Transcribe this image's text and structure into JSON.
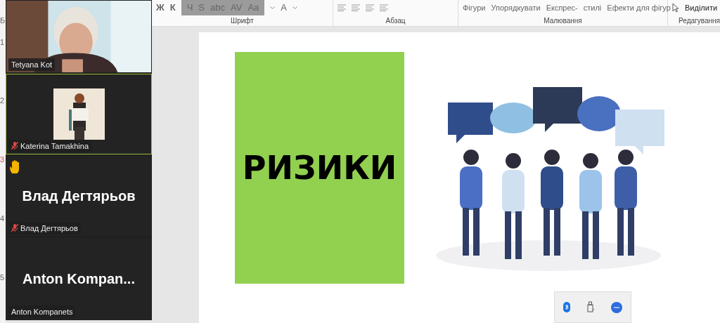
{
  "ruler": {
    "marks": [
      {
        "label": "Б",
        "highlighted": false
      },
      {
        "label": "1",
        "highlighted": false
      },
      {
        "label": "2",
        "highlighted": false
      },
      {
        "label": "3",
        "highlighted": true
      },
      {
        "label": "4",
        "highlighted": false
      },
      {
        "label": "5",
        "highlighted": false
      }
    ]
  },
  "participants": [
    {
      "kind": "video",
      "name": "Tetyana Kot",
      "muted": false,
      "hand_raised": false,
      "selected": false
    },
    {
      "kind": "avatar",
      "name": "Katerina Tamakhina",
      "muted": true,
      "hand_raised": false,
      "selected": true
    },
    {
      "kind": "text",
      "display_name": "Влад Дегтярьов",
      "name": "Влад Дегтярьов",
      "muted": true,
      "hand_raised": true,
      "selected": false
    },
    {
      "kind": "text",
      "display_name": "Anton  Kompan...",
      "name": "Anton Kompanets",
      "muted": false,
      "hand_raised": false,
      "selected": false
    }
  ],
  "ribbon": {
    "font_buttons": [
      "Ж",
      "К"
    ],
    "floating_buttons": [
      "Ч",
      "S",
      "abc",
      "AV",
      "Aa"
    ],
    "font_color_button": "A",
    "drawing_top": [
      "Фігури",
      "Упорядкувати",
      "Експрес-"
    ],
    "quick_styles": "стилі",
    "shape_effects": "Ефекти для фігур",
    "select": "Виділити",
    "groups": [
      {
        "label": "Шрифт"
      },
      {
        "label": "Абзац"
      },
      {
        "label": "Малювання"
      },
      {
        "label": "Редагування"
      }
    ]
  },
  "slide": {
    "title": "РИЗИКИ"
  }
}
